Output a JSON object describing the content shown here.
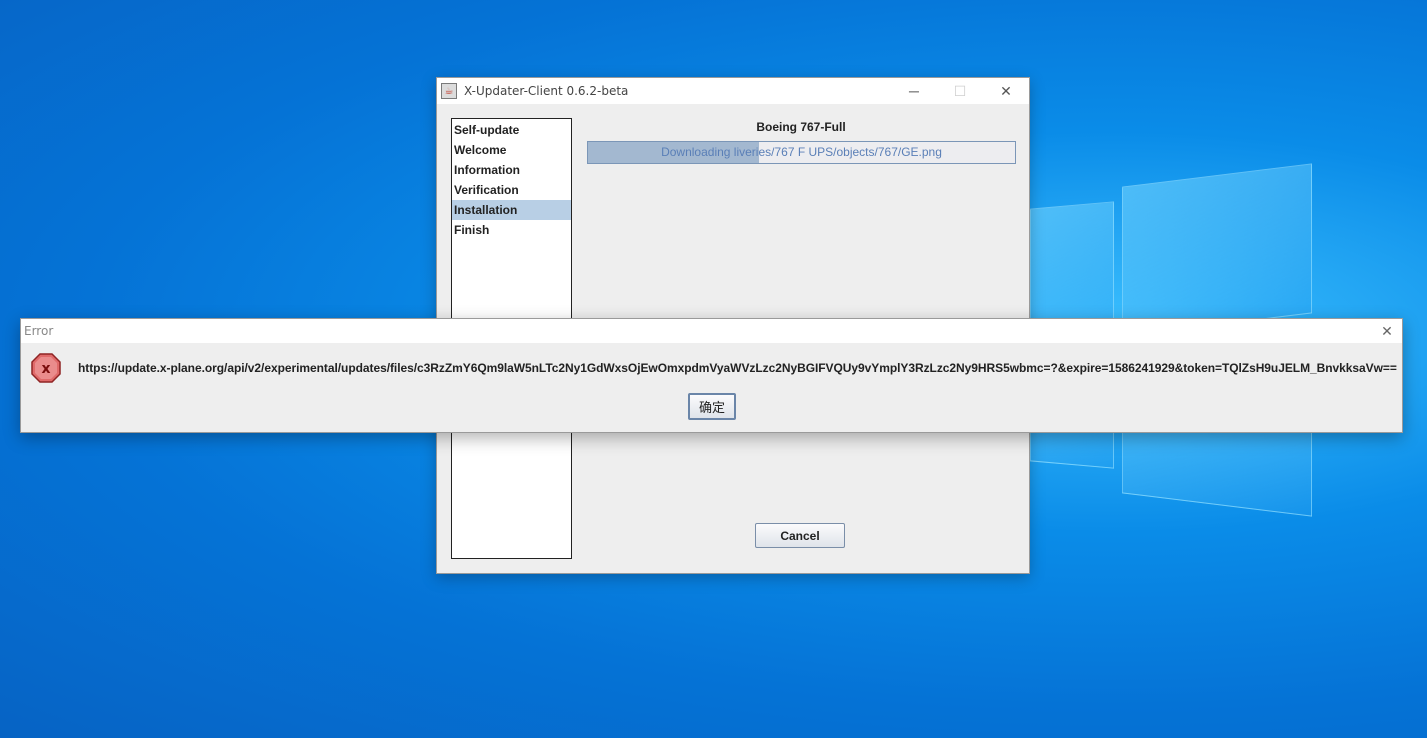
{
  "main_window": {
    "title": "X-Updater-Client 0.6.2-beta",
    "controls": {
      "minimize": "─",
      "maximize": "☐",
      "close": "✕"
    },
    "steps": [
      {
        "label": "Self-update",
        "active": false
      },
      {
        "label": "Welcome",
        "active": false
      },
      {
        "label": "Information",
        "active": false
      },
      {
        "label": "Verification",
        "active": false
      },
      {
        "label": "Installation",
        "active": true
      },
      {
        "label": "Finish",
        "active": false
      }
    ],
    "package_title": "Boeing 767-Full",
    "progress": {
      "text": "Downloading liveries/767 F UPS/objects/767/GE.png",
      "fraction": 0.4
    },
    "cancel_label": "Cancel"
  },
  "error_dialog": {
    "title": "Error",
    "close": "✕",
    "icon": "error-x-icon",
    "message": "https://update.x-plane.org/api/v2/experimental/updates/files/c3RzZmY6Qm9laW5nLTc2Ny1GdWxsOjEwOmxpdmVyaWVzLzc2NyBGIFVQUy9vYmplY3RzLzc2Ny9HRS5wbmc=?&expire=1586241929&token=TQlZsH9uJELM_BnvkksaVw==",
    "ok_label": "确定"
  }
}
